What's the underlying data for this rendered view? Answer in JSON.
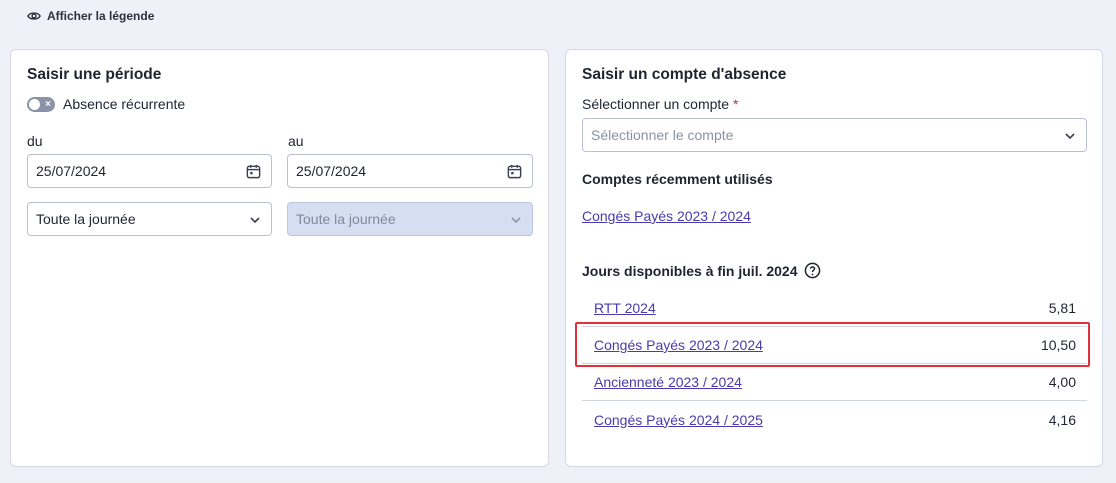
{
  "header": {
    "legend_toggle_label": "Afficher la légende"
  },
  "period": {
    "title": "Saisir une période",
    "recurrent_label": "Absence récurrente",
    "from_label": "du",
    "to_label": "au",
    "from_date": "25/07/2024",
    "to_date": "25/07/2024",
    "from_period": "Toute la journée",
    "to_period": "Toute la journée"
  },
  "account": {
    "title": "Saisir un compte d'absence",
    "select_label": "Sélectionner un compte",
    "required_mark": "*",
    "select_placeholder": "Sélectionner le compte",
    "recent_title": "Comptes récemment utilisés",
    "recent_items": [
      "Congés Payés 2023 / 2024"
    ],
    "available_title": "Jours disponibles à fin juil. 2024",
    "available": [
      {
        "name": "RTT 2024",
        "value": "5,81"
      },
      {
        "name": "Congés Payés 2023 / 2024",
        "value": "10,50"
      },
      {
        "name": "Ancienneté 2023 / 2024",
        "value": "4,00"
      },
      {
        "name": "Congés Payés 2024 / 2025",
        "value": "4,16"
      }
    ]
  },
  "colors": {
    "highlight": "#e0313a",
    "link": "#4a3ab0",
    "disabled_field": "#d6dff1"
  }
}
